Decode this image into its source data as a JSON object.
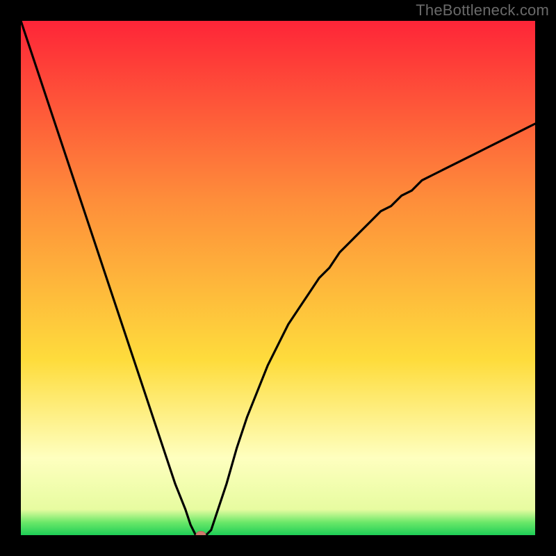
{
  "watermark": "TheBottleneck.com",
  "colors": {
    "page_bg": "#000000",
    "curve": "#000000",
    "marker_fill": "#cf7a6e",
    "marker_stroke": "#b5675c",
    "gradient_top": "#fe2538",
    "gradient_mid1": "#fe8e3a",
    "gradient_mid2": "#fedc3c",
    "gradient_lowlight": "#feffbf",
    "gradient_green1": "#6be869",
    "gradient_green2": "#1ece57"
  },
  "chart_data": {
    "type": "line",
    "title": "",
    "xlabel": "",
    "ylabel": "",
    "xlim": [
      0,
      100
    ],
    "ylim": [
      0,
      100
    ],
    "x": [
      0,
      2,
      4,
      6,
      8,
      10,
      12,
      14,
      16,
      18,
      20,
      22,
      24,
      26,
      28,
      30,
      32,
      33,
      34,
      35,
      36,
      37,
      38,
      40,
      42,
      44,
      46,
      48,
      50,
      52,
      54,
      56,
      58,
      60,
      62,
      64,
      66,
      68,
      70,
      72,
      74,
      76,
      78,
      80,
      82,
      84,
      86,
      88,
      90,
      92,
      94,
      96,
      98,
      100
    ],
    "values": [
      100,
      94,
      88,
      82,
      76,
      70,
      64,
      58,
      52,
      46,
      40,
      34,
      28,
      22,
      16,
      10,
      5,
      2,
      0,
      0,
      0,
      1,
      4,
      10,
      17,
      23,
      28,
      33,
      37,
      41,
      44,
      47,
      50,
      52,
      55,
      57,
      59,
      61,
      63,
      64,
      66,
      67,
      69,
      70,
      71,
      72,
      73,
      74,
      75,
      76,
      77,
      78,
      79,
      80
    ],
    "marker": {
      "x": 35,
      "y": 0
    }
  }
}
